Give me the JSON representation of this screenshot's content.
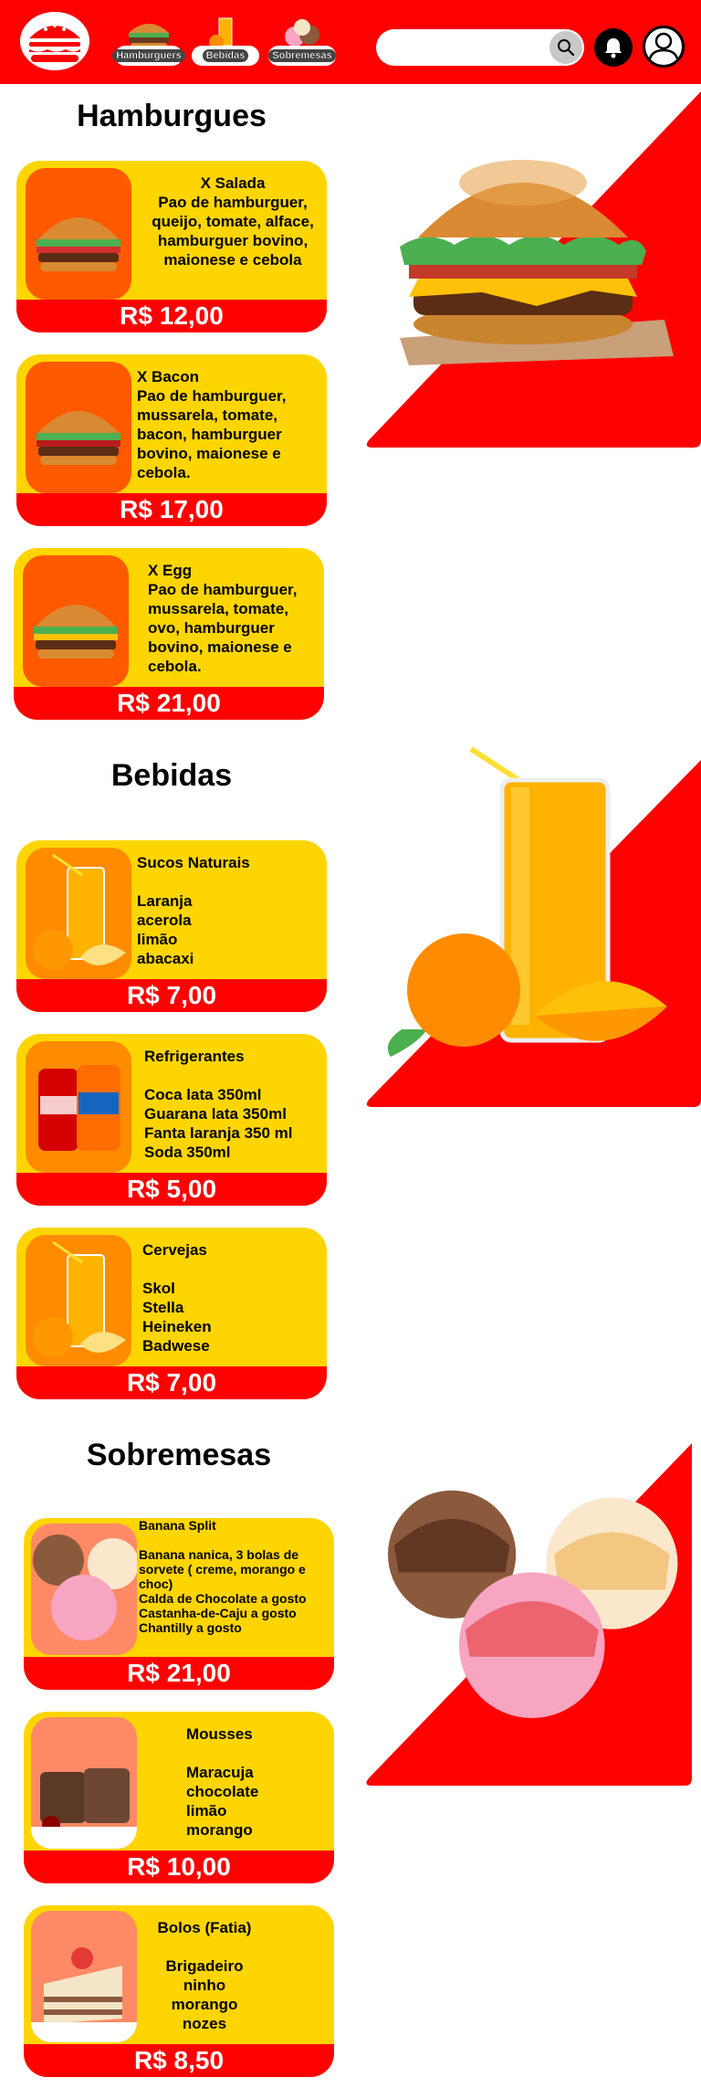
{
  "header": {
    "categories": [
      "Hamburguers",
      "Bebidas",
      "Sobremesas"
    ],
    "search_placeholder": ""
  },
  "sections": {
    "burgers": {
      "title": "Hamburgues",
      "items": [
        {
          "name": "X Salada",
          "desc": "Pao de hamburguer,\nqueijo, tomate, alface,\nhamburguer bovino,\nmaionese e cebola",
          "price": "R$ 12,00"
        },
        {
          "name": "X Bacon",
          "desc": "Pao de hamburguer,\nmussarela, tomate,\n bacon, hamburguer\n bovino, maionese e\ncebola.",
          "price": "R$ 17,00"
        },
        {
          "name": "X Egg",
          "desc": "Pao de hamburguer,\nmussarela, tomate,\n ovo, hamburguer\n bovino, maionese e\ncebola.",
          "price": "R$ 21,00"
        }
      ]
    },
    "drinks": {
      "title": "Bebidas",
      "items": [
        {
          "name": "Sucos Naturais",
          "desc": "\nLaranja\nacerola\nlimão\nabacaxi",
          "price": "R$ 7,00"
        },
        {
          "name": "Refrigerantes",
          "desc": "\nCoca lata 350ml\nGuarana lata 350ml\nFanta laranja 350 ml\nSoda 350ml",
          "price": "R$ 5,00"
        },
        {
          "name": "Cervejas",
          "desc": "\nSkol\nStella\nHeineken\nBadwese",
          "price": "R$ 7,00"
        }
      ]
    },
    "desserts": {
      "title": "Sobremesas",
      "items": [
        {
          "name": "Banana Split",
          "desc": "\nBanana nanica, 3 bolas de\nsorvete ( creme, morango e\nchoc)\nCalda de Chocolate a gosto\nCastanha-de-Caju a gosto\nChantilly a gosto",
          "price": "R$ 21,00"
        },
        {
          "name": "Mousses",
          "desc": "\nMaracuja\nchocolate\nlimão\nmorango",
          "price": "R$ 10,00"
        },
        {
          "name": "Bolos (Fatia)",
          "desc": "\nBrigadeiro\nninho\nmorango\nnozes",
          "price": "R$ 8,50"
        }
      ]
    }
  },
  "colors": {
    "brand_red": "#ff0000",
    "card_yellow": "#ffd500",
    "image_orange": "#ff5a00"
  }
}
